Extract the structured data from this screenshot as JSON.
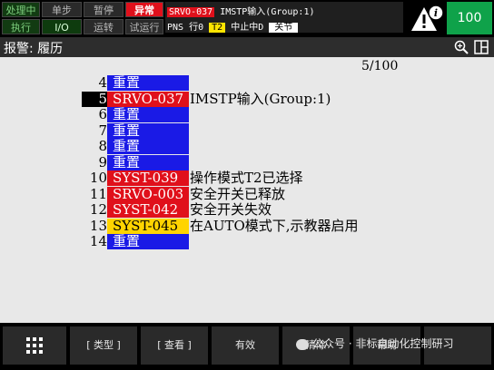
{
  "status": {
    "row1": [
      "处理中",
      "单步",
      "暂停",
      "异常"
    ],
    "row2": [
      "执行",
      "I/O",
      "运转",
      "试运行"
    ]
  },
  "message": {
    "code": "SRVO-037",
    "text": " IMSTP输入(Group:1)",
    "line2_prefix": "PNS 行0 ",
    "t2": "T2",
    "state": " 中止中D ",
    "close": "关节"
  },
  "override": "100",
  "title": "报警: 履历",
  "page_indicator": "5/100",
  "alarms": [
    {
      "num": "4",
      "code": "重置",
      "desc": "",
      "color": "blue",
      "selected": false
    },
    {
      "num": "5",
      "code": "SRVO-037",
      "desc": "IMSTP输入(Group:1)",
      "color": "red",
      "selected": true
    },
    {
      "num": "6",
      "code": "重置",
      "desc": "",
      "color": "blue",
      "selected": false
    },
    {
      "num": "7",
      "code": "重置",
      "desc": "",
      "color": "blue",
      "selected": false
    },
    {
      "num": "8",
      "code": "重置",
      "desc": "",
      "color": "blue",
      "selected": false
    },
    {
      "num": "9",
      "code": "重置",
      "desc": "",
      "color": "blue",
      "selected": false
    },
    {
      "num": "10",
      "code": "SYST-039",
      "desc": "操作模式T2已选择",
      "color": "red",
      "selected": false
    },
    {
      "num": "11",
      "code": "SRVO-003",
      "desc": "安全开关已释放",
      "color": "red",
      "selected": false
    },
    {
      "num": "12",
      "code": "SYST-042",
      "desc": "安全开关失效",
      "color": "red",
      "selected": false
    },
    {
      "num": "13",
      "code": "SYST-045",
      "desc": "在AUTO模式下,示教器启用",
      "color": "yellow",
      "selected": false
    },
    {
      "num": "14",
      "code": "重置",
      "desc": "",
      "color": "blue",
      "selected": false
    }
  ],
  "footer": {
    "menu_icon": "grid-icon",
    "type_label": "[ 类型 ]",
    "view_label": "[ 查看 ]",
    "valid_label": "有效",
    "clear_label": "清除",
    "help_label": "帮助",
    "overlay_text": "公众号 · 非标自动化控制研习"
  },
  "colors": {
    "alarm_red": "#e0101b",
    "reset_blue": "#1a1ae6",
    "warn_yellow": "#ffd400",
    "override_green": "#0fa24a"
  }
}
